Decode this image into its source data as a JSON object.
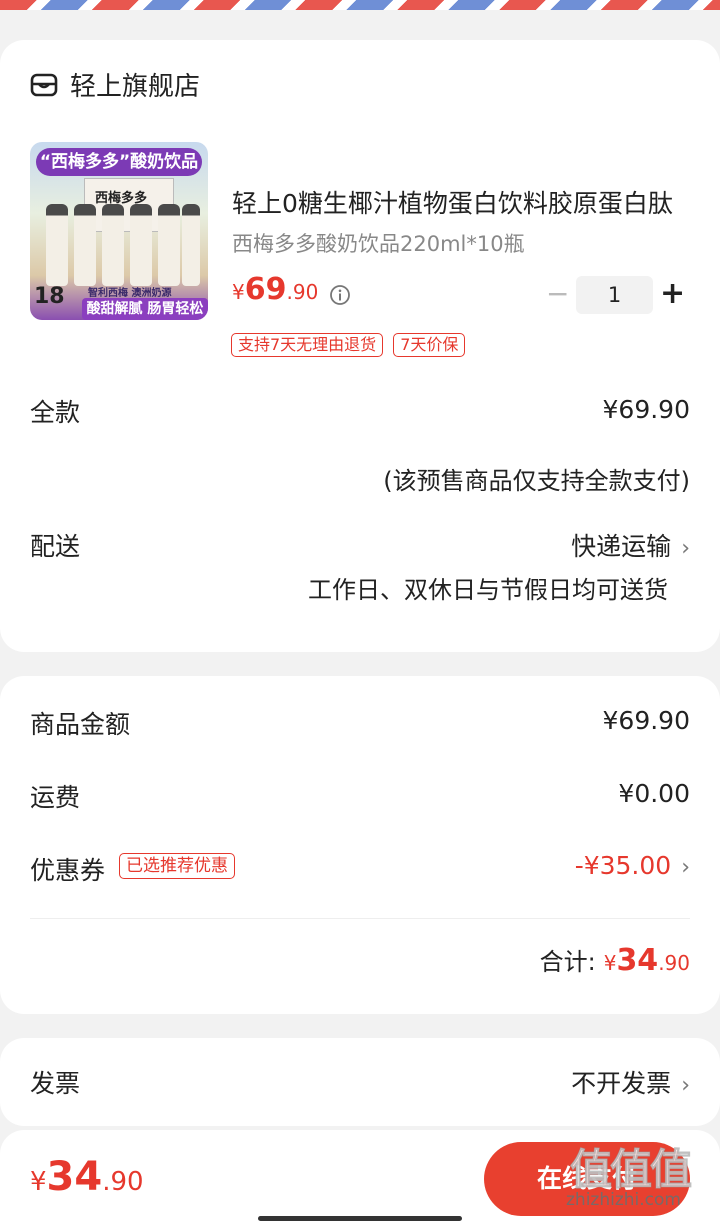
{
  "store": {
    "name": "轻上旗舰店",
    "icon": "store-icon"
  },
  "product": {
    "title": "轻上0糖生椰汁植物蛋白饮料胶原蛋白肽",
    "spec": "西梅多多酸奶饮品220ml*10瓶",
    "price_currency": "¥",
    "price_int": "69",
    "price_dec": ".90",
    "quantity": "1",
    "minus": "−",
    "plus": "+",
    "tags": [
      "支持7天无理由退货",
      "7天价保"
    ],
    "image": {
      "banner": "“西梅多多”酸奶饮品",
      "box_label": "西梅多多",
      "count": "18",
      "slogan1": "智利西梅 澳洲奶源",
      "slogan2": "酸甜解腻 肠胃轻松"
    }
  },
  "payment": {
    "full_label": "全款",
    "full_value": "¥69.90",
    "full_note": "(该预售商品仅支持全款支付)"
  },
  "delivery": {
    "label": "配送",
    "method": "快递运输",
    "note": "工作日、双休日与节假日均可送货"
  },
  "summary": {
    "goods_label": "商品金额",
    "goods_value": "¥69.90",
    "shipping_label": "运费",
    "shipping_value": "¥0.00",
    "coupon_label": "优惠券",
    "coupon_tag": "已选推荐优惠",
    "coupon_value": "-¥35.00",
    "total_label": "合计:",
    "total_currency": "¥",
    "total_int": "34",
    "total_dec": ".90"
  },
  "invoice": {
    "label": "发票",
    "value": "不开发票"
  },
  "bottom": {
    "currency": "¥",
    "int": "34",
    "dec": ".90",
    "pay_label": "在线支付"
  },
  "watermark": {
    "logo": "值值值",
    "text": "zhizhizhi.com"
  },
  "colors": {
    "accent": "#e6382d",
    "pay_button": "#e8402f"
  }
}
